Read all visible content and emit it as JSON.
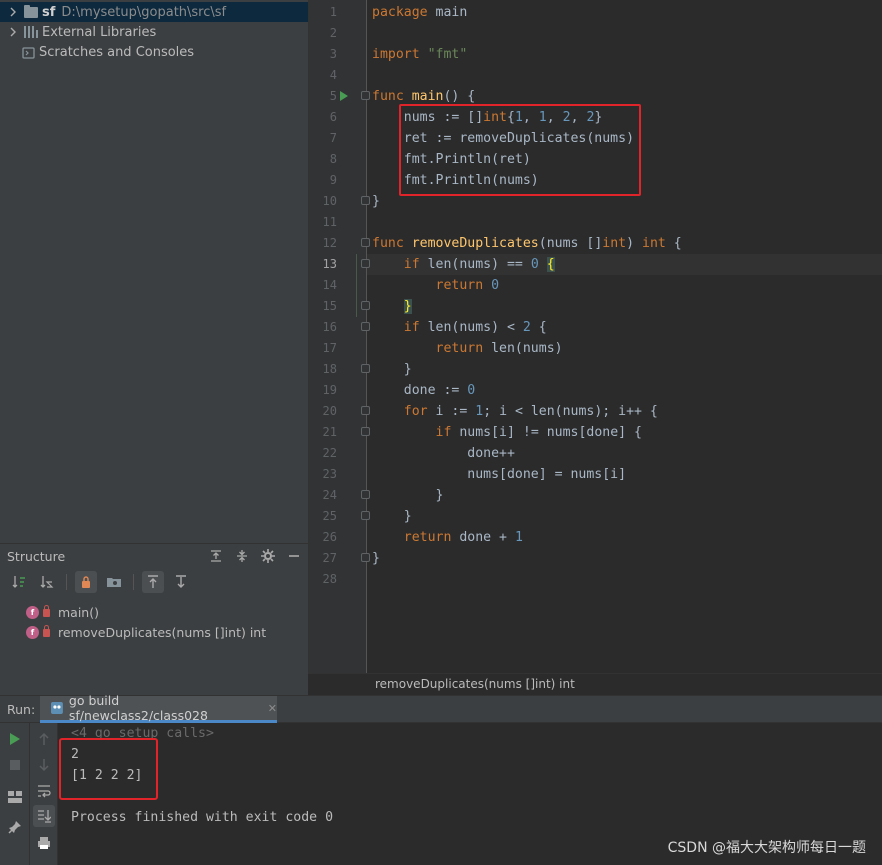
{
  "project_tree": {
    "root": {
      "name": "sf",
      "path": "D:\\mysetup\\gopath\\src\\sf"
    },
    "items": [
      {
        "label": "External Libraries"
      },
      {
        "label": "Scratches and Consoles"
      }
    ]
  },
  "structure": {
    "title": "Structure",
    "items": [
      {
        "badge": "f",
        "label": "main()"
      },
      {
        "badge": "f",
        "label": "removeDuplicates(nums []int) int"
      }
    ]
  },
  "editor": {
    "line_numbers": [
      "1",
      "2",
      "3",
      "4",
      "5",
      "6",
      "7",
      "8",
      "9",
      "10",
      "11",
      "12",
      "13",
      "14",
      "15",
      "16",
      "17",
      "18",
      "19",
      "20",
      "21",
      "22",
      "23",
      "24",
      "25",
      "26",
      "27",
      "28"
    ],
    "current_line": "13",
    "breadcrumb": "removeDuplicates(nums []int) int",
    "code": {
      "l1_kw": "package",
      "l1_rest": " main",
      "l3_kw": "import",
      "l3_str": "\"fmt\"",
      "l5_kw": "func",
      "l5_fn": "main",
      "l5_rest": "() {",
      "l6_a": "    nums := []",
      "l6_kw": "int",
      "l6_b": "{",
      "l6_n1": "1",
      "l6_c1": ", ",
      "l6_n2": "1",
      "l6_c2": ", ",
      "l6_n3": "2",
      "l6_c3": ", ",
      "l6_n4": "2",
      "l6_d": "}",
      "l7": "    ret := removeDuplicates(nums)",
      "l8": "    fmt.Println(ret)",
      "l9": "    fmt.Println(nums)",
      "l10": "}",
      "l12_kw": "func",
      "l12_fn": "removeDuplicates",
      "l12_a": "(nums []",
      "l12_kw2": "int",
      "l12_b": ") ",
      "l12_kw3": "int",
      "l12_c": " {",
      "l13_kw": "if",
      "l13_a": " len(nums) == ",
      "l13_n": "0",
      "l13_sp": " ",
      "l13_brace": "{",
      "l14_kw": "return",
      "l14_n": "0",
      "l15_brace": "}",
      "l16_kw": "if",
      "l16_a": " len(nums) < ",
      "l16_n": "2",
      "l16_b": " {",
      "l17_kw": "return",
      "l17_a": " len(nums)",
      "l18": "    }",
      "l19_a": "    done := ",
      "l19_n": "0",
      "l20_kw": "for",
      "l20_a": " i := ",
      "l20_n": "1",
      "l20_b": "; i < len(nums); i++ {",
      "l21_kw": "if",
      "l21_a": " nums[i] != nums[done] {",
      "l22": "            done++",
      "l23": "            nums[done] = nums[i]",
      "l24": "        }",
      "l25": "    }",
      "l26_kw": "return",
      "l26_a": " done + ",
      "l26_n": "1",
      "l27": "}"
    }
  },
  "run": {
    "label": "Run:",
    "tab": "go build sf/newclass2/class028",
    "console": [
      "<4 go setup calls>",
      "2",
      "[1 2 2 2]",
      "",
      "Process finished with exit code 0"
    ]
  },
  "watermark": "CSDN @福大大架构师每日一题",
  "colors": {
    "highlight_box": "#e0242a",
    "keyword": "#cc7832",
    "function": "#ffc66d",
    "number": "#6897bb",
    "string": "#6a8759"
  }
}
